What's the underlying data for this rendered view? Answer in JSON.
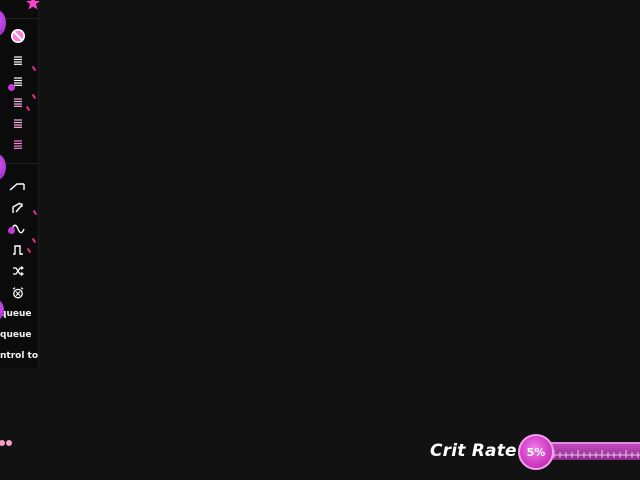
{
  "toolbar": {
    "icons": {
      "star": "star-icon",
      "block": "no-entry-icon",
      "lines": [
        "list-icon",
        "list-icon",
        "list-icon",
        "list-icon",
        "list-icon"
      ],
      "waves": [
        "ramp-wave-icon",
        "sawtooth-wave-icon",
        "sine-wave-icon",
        "square-wave-icon",
        "shuffle-icon",
        "alarm-clock-icon"
      ]
    },
    "labels": {
      "queue_1": "queue",
      "queue_2": "queue",
      "control": "ntrol toy"
    }
  },
  "hud": {
    "crit_label": "Crit Rate",
    "crit_value": "5%",
    "crit_fraction": 0.05
  },
  "colors": {
    "background": "#121212",
    "toolbar": "#0b0b0b",
    "accent_purple": "#b832d8",
    "accent_pink": "#e02f8a",
    "orb": "#d23fc7"
  }
}
